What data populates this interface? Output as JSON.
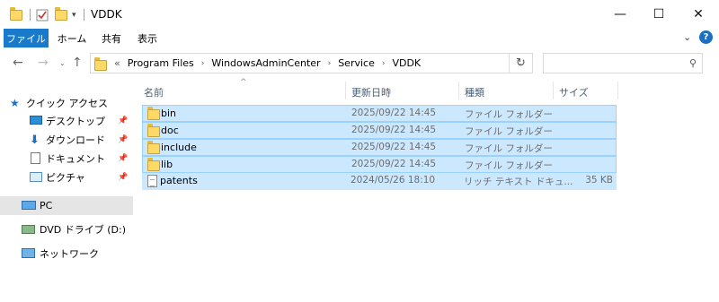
{
  "window": {
    "title": "VDDK",
    "minimize": "—",
    "maximize": "☐",
    "close": "✕"
  },
  "ribbon": {
    "tabs": [
      "ファイル",
      "ホーム",
      "共有",
      "表示"
    ],
    "help": "?"
  },
  "address": {
    "more": "«",
    "crumbs": [
      "Program Files",
      "WindowsAdminCenter",
      "Service",
      "VDDK"
    ],
    "search_placeholder": ""
  },
  "nav": {
    "quick_access": "クイック アクセス",
    "items": [
      {
        "label": "デスクトップ",
        "icon": "desktop-icon",
        "pinned": true
      },
      {
        "label": "ダウンロード",
        "icon": "download-icon",
        "pinned": true
      },
      {
        "label": "ドキュメント",
        "icon": "documents-icon",
        "pinned": true
      },
      {
        "label": "ピクチャ",
        "icon": "pictures-icon",
        "pinned": true
      }
    ],
    "pc": "PC",
    "dvd": "DVD ドライブ (D:) SSS_X",
    "network": "ネットワーク"
  },
  "columns": {
    "name": "名前",
    "date": "更新日時",
    "type": "種類",
    "size": "サイズ"
  },
  "files": [
    {
      "name": "bin",
      "date": "2025/09/22 14:45",
      "type": "ファイル フォルダー",
      "size": "",
      "icon": "folder-icon"
    },
    {
      "name": "doc",
      "date": "2025/09/22 14:45",
      "type": "ファイル フォルダー",
      "size": "",
      "icon": "folder-icon"
    },
    {
      "name": "include",
      "date": "2025/09/22 14:45",
      "type": "ファイル フォルダー",
      "size": "",
      "icon": "folder-icon"
    },
    {
      "name": "lib",
      "date": "2025/09/22 14:45",
      "type": "ファイル フォルダー",
      "size": "",
      "icon": "folder-icon"
    },
    {
      "name": "patents",
      "date": "2024/05/26 18:10",
      "type": "リッチ テキスト ドキュ...",
      "size": "35 KB",
      "icon": "rtf-document-icon"
    }
  ],
  "colors": {
    "accent": "#1979ca",
    "selection": "#cce8ff",
    "selection_border": "#99d1ff"
  }
}
